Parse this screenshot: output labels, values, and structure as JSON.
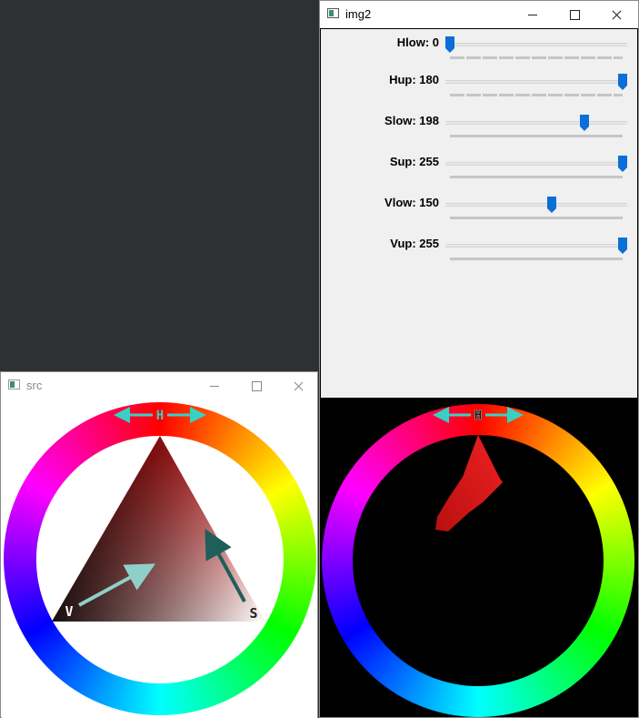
{
  "img2_window": {
    "title": "img2",
    "trackbars": [
      {
        "label": "Hlow: 0",
        "value": 0,
        "max": 180,
        "ticks": "dashed"
      },
      {
        "label": "Hup: 180",
        "value": 180,
        "max": 180,
        "ticks": "dashed"
      },
      {
        "label": "Slow: 198",
        "value": 198,
        "max": 255,
        "ticks": "solid"
      },
      {
        "label": "Sup: 255",
        "value": 255,
        "max": 255,
        "ticks": "solid"
      },
      {
        "label": "Vlow: 150",
        "value": 150,
        "max": 255,
        "ticks": "solid"
      },
      {
        "label": "Vup: 255",
        "value": 255,
        "max": 255,
        "ticks": "solid"
      }
    ]
  },
  "src_window": {
    "title": "src"
  },
  "diagram": {
    "hue_label": "H",
    "value_label": "V",
    "saturation_label": "S"
  },
  "colors": {
    "accent": "#0a6fd6",
    "arrow_cyan": "#39d0c4",
    "arrow_dark": "#1f5f5a",
    "arrow_light": "#8fcfc7"
  }
}
